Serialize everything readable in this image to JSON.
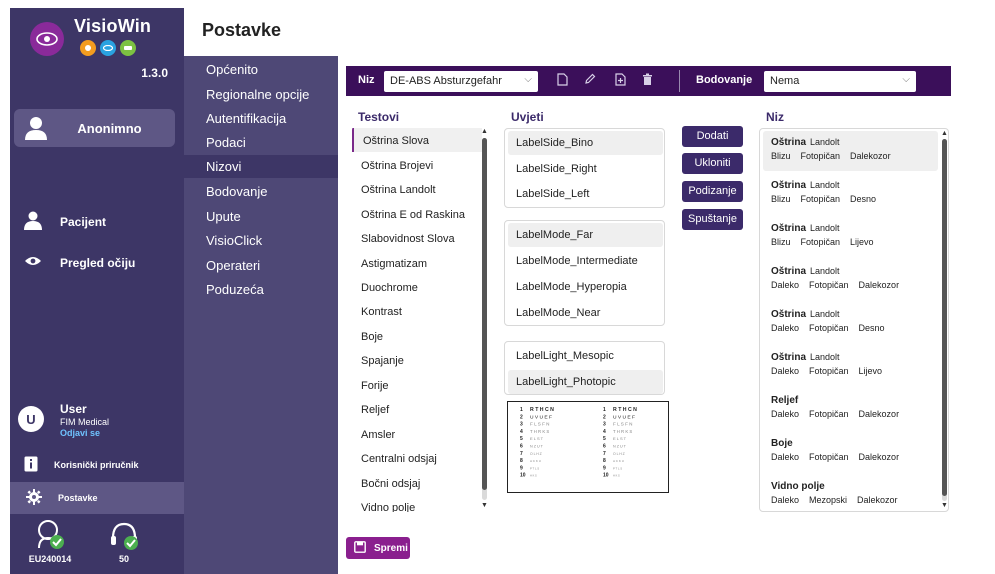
{
  "app": {
    "title": "VisioWin",
    "version": "1.3.0",
    "brand_color": "#3d3666",
    "accent_color": "#8a1f8e"
  },
  "sidebar": {
    "current_user_card": "Anonimno",
    "links": [
      {
        "label": "Pacijent",
        "icon": "person-icon"
      },
      {
        "label": "Pregled očiju",
        "icon": "eye-icon"
      }
    ],
    "user": {
      "initial": "U",
      "name": "User",
      "org": "FIM Medical",
      "logout": "Odjavi se"
    },
    "manual": "Korisnički priručnik",
    "settings": "Postavke",
    "devices": [
      {
        "label": "EU240014",
        "icon": "device-head-icon"
      },
      {
        "label": "50",
        "icon": "headset-icon"
      }
    ]
  },
  "page": {
    "title": "Postavke"
  },
  "nav": {
    "items": [
      "Općenito",
      "Regionalne opcije",
      "Autentifikacija",
      "Podaci",
      "Nizovi",
      "Bodovanje",
      "Upute",
      "VisioClick",
      "Operateri",
      "Poduzeća"
    ],
    "active_index": 4
  },
  "toolbar": {
    "niz_label": "Niz",
    "niz_value": "DE-ABS Absturzgefahr",
    "bodovanje_label": "Bodovanje",
    "bodovanje_value": "Nema"
  },
  "columns": {
    "tests": "Testovi",
    "conditions": "Uvjeti",
    "series": "Niz"
  },
  "tests": [
    "Oštrina Slova",
    "Oštrina Brojevi",
    "Oštrina Landolt",
    "Oštrina E od Raskina",
    "Slabovidnost Slova",
    "Astigmatizam",
    "Duochrome",
    "Kontrast",
    "Boje",
    "Spajanje",
    "Forije",
    "Reljef",
    "Amsler",
    "Centralni odsjaj",
    "Bočni odsjaj",
    "Vidno polje"
  ],
  "conditions": {
    "side": [
      "LabelSide_Bino",
      "LabelSide_Right",
      "LabelSide_Left"
    ],
    "mode": [
      "LabelMode_Far",
      "LabelMode_Intermediate",
      "LabelMode_Hyperopia",
      "LabelMode_Near"
    ],
    "light": [
      "LabelLight_Mesopic",
      "LabelLight_Photopic"
    ]
  },
  "actions": {
    "add": "Dodati",
    "remove": "Ukloniti",
    "up": "Podizanje",
    "down": "Spuštanje"
  },
  "series": [
    {
      "title": "Oštrina",
      "sub": "Landolt",
      "tags": [
        "Blizu",
        "Fotopičan",
        "Dalekozor"
      ]
    },
    {
      "title": "Oštrina",
      "sub": "Landolt",
      "tags": [
        "Blizu",
        "Fotopičan",
        "Desno"
      ]
    },
    {
      "title": "Oštrina",
      "sub": "Landolt",
      "tags": [
        "Blizu",
        "Fotopičan",
        "Lijevo"
      ]
    },
    {
      "title": "Oštrina",
      "sub": "Landolt",
      "tags": [
        "Daleko",
        "Fotopičan",
        "Dalekozor"
      ]
    },
    {
      "title": "Oštrina",
      "sub": "Landolt",
      "tags": [
        "Daleko",
        "Fotopičan",
        "Desno"
      ]
    },
    {
      "title": "Oštrina",
      "sub": "Landolt",
      "tags": [
        "Daleko",
        "Fotopičan",
        "Lijevo"
      ]
    },
    {
      "title": "Reljef",
      "sub": "",
      "tags": [
        "Daleko",
        "Fotopičan",
        "Dalekozor"
      ]
    },
    {
      "title": "Boje",
      "sub": "",
      "tags": [
        "Daleko",
        "Fotopičan",
        "Dalekozor"
      ]
    },
    {
      "title": "Vidno polje",
      "sub": "",
      "tags": [
        "Daleko",
        "Mezopski",
        "Dalekozor"
      ]
    }
  ],
  "chart_preview": {
    "rows": [
      {
        "n": "1",
        "text": "R T H C N"
      },
      {
        "n": "2",
        "text": "U V U E F"
      },
      {
        "n": "3",
        "text": "F L S F N"
      },
      {
        "n": "4",
        "text": "T H R K S"
      },
      {
        "n": "5",
        "text": "E L S T"
      },
      {
        "n": "6",
        "text": "N Z U T"
      },
      {
        "n": "7",
        "text": "O L H Z"
      },
      {
        "n": "8",
        "text": "A C K U"
      },
      {
        "n": "9",
        "text": "P T L S"
      },
      {
        "n": "10",
        "text": "H K S"
      }
    ]
  },
  "save": "Spremi"
}
